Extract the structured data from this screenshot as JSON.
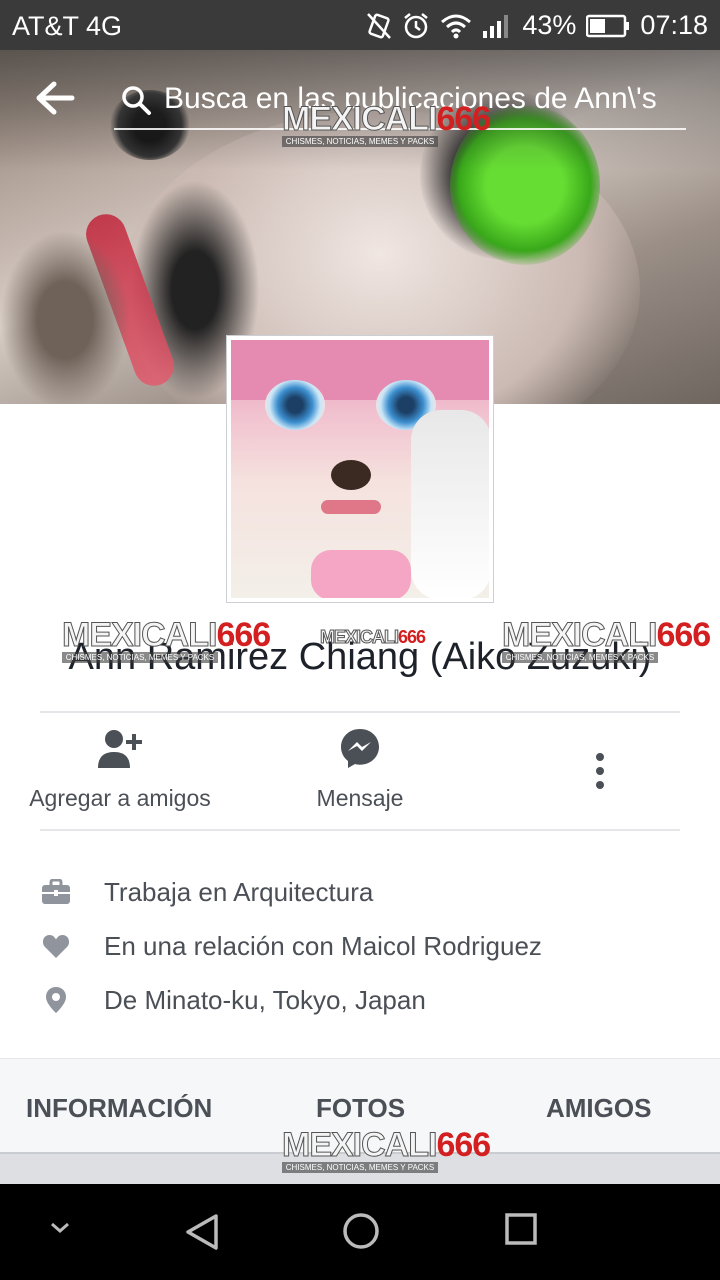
{
  "status_bar": {
    "carrier": "AT&T 4G",
    "battery": "43%",
    "time": "07:18"
  },
  "search": {
    "placeholder": "Busca en las publicaciones de Ann\\'s"
  },
  "watermark": {
    "brand_white": "MEXICALI",
    "brand_red": "666",
    "tagline": "CHISMES, NOTICIAS, MEMES Y PACKS"
  },
  "profile": {
    "name": "Ann Ramirez Chiang (Aiko Zuzuki)"
  },
  "actions": {
    "add_friend": "Agregar a amigos",
    "message": "Mensaje"
  },
  "intro": {
    "work": "Trabaja en Arquitectura",
    "relationship": "En una relación con Maicol Rodriguez",
    "hometown": "De Minato-ku, Tokyo, Japan"
  },
  "tabs": {
    "info": "INFORMACIÓN",
    "photos": "FOTOS",
    "friends": "AMIGOS"
  },
  "icons": {
    "accent": "#4b4f56",
    "icon_gray": "#90949c"
  }
}
